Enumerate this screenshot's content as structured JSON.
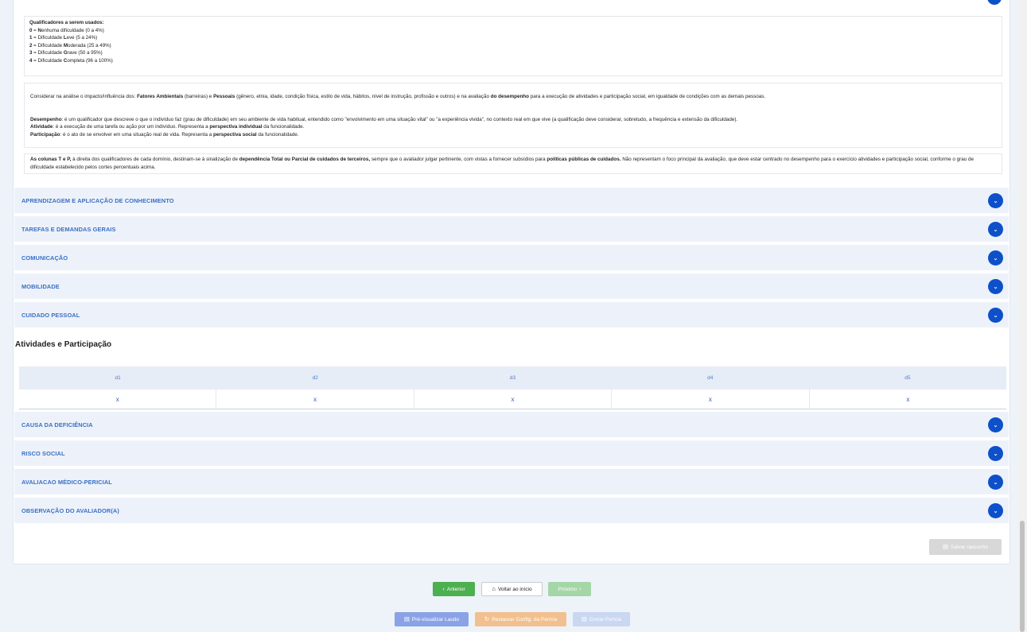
{
  "qualifiers": {
    "title": "Qualificadores a serem usados:",
    "items": [
      {
        "num": "0",
        "sep": " = ",
        "letter": "N",
        "rest": "enhuma dificuldade (0 a 4%)"
      },
      {
        "num": "1",
        "sep": " = Dificuldade ",
        "letter": "L",
        "rest": "eve (5 a 24%)"
      },
      {
        "num": "2",
        "sep": " = Dificuldade ",
        "letter": "M",
        "rest": "oderada (25 a 49%)"
      },
      {
        "num": "3",
        "sep": " = Dificuldade ",
        "letter": "G",
        "rest": "rave (50 a 95%)"
      },
      {
        "num": "4",
        "sep": " = Dificuldade ",
        "letter": "C",
        "rest": "ompleta (96 a 100%)"
      }
    ]
  },
  "info": {
    "p1_a": "Considerar na análise o impacto/influência dos: ",
    "p1_b": "Fatores Ambientais",
    "p1_c": " (barreiras) e ",
    "p1_d": "Pessoais",
    "p1_e": " (gênero, etnia, idade, condição física, estilo de vida, hábitos, nível de instrução, profissão e outros) e na avaliação ",
    "p1_f": "do desempenho",
    "p1_g": " para a execução de atividades e participação social, em igualdade de condições com as demais pessoas.",
    "p2_a": "Desempenho",
    "p2_b": ": é um qualificador que descreve o que o indivíduo faz (grau de dificuldade) em seu ambiente de vida habitual, entendido como \"envolvimento em uma situação vital\" ou \"a experiência vivida\", no contexto real em que vive (a qualificação deve considerar, sobretudo, a frequência e extensão da dificuldade).",
    "p3_a": "Atividade",
    "p3_b": ": é a execução de uma tarefa ou ação por um indivíduo. Representa a ",
    "p3_c": "perspectiva individual",
    "p3_d": " da funcionalidade.",
    "p4_a": "Participação",
    "p4_b": ": é o ato de se envolver em uma situação real de vida. Representa a ",
    "p4_c": "perspectiva social",
    "p4_d": " da funcionalidade."
  },
  "columns_note": {
    "a": "As colunas T e P,",
    "b": " à direita dos qualificadores de cada domínio, destinam-se à sinalização de ",
    "c": "dependência Total ou Parcial de cuidados de terceiros,",
    "d": " sempre que o avaliador julgar pertinente, com vistas a fornecer subsídios para ",
    "e": "políticas públicas de cuidados.",
    "f": " Não representam o foco principal da avaliação, que deve estar centrado no desempenho para o exercício atividades e participação social, conforme o grau de dificuldade estabelecido pelos cortes percentuais acima."
  },
  "accordions_top": [
    "APRENDIZAGEM E APLICAÇÃO DE CONHECIMENTO",
    "TAREFAS E DEMANDAS GERAIS",
    "COMUNICAÇÃO",
    "MOBILIDADE",
    "CUIDADO PESSOAL"
  ],
  "section_title": "Atividades e Participação",
  "table": {
    "headers": [
      "d1",
      "d2",
      "d3",
      "d4",
      "d5"
    ],
    "values": [
      "x",
      "x",
      "x",
      "x",
      "x"
    ]
  },
  "accordions_bottom": [
    "CAUSA DA DEFICIÊNCIA",
    "RISCO SOCIAL",
    "AVALIACAO MÉDICO-PERICIAL",
    "OBSERVAÇÃO DO AVALIADOR(A)"
  ],
  "buttons": {
    "save": "Salvar rascunho",
    "previous": "Anterior",
    "home": "Voltar ao início",
    "next": "Próximo",
    "preview": "Pré-visualizar Laudo",
    "restore": "Restaurar Config. da Perícia",
    "send": "Enviar Perícia"
  },
  "icons": {
    "chevron": "chevron-down-icon",
    "home": "home-icon",
    "document": "document-icon",
    "refresh": "refresh-icon"
  },
  "colors": {
    "primary": "#0d50c9",
    "accordion_bg": "#edf2fa",
    "accordion_text": "#3a6fc4",
    "success": "#4caf50",
    "warning": "#f2c08e"
  }
}
